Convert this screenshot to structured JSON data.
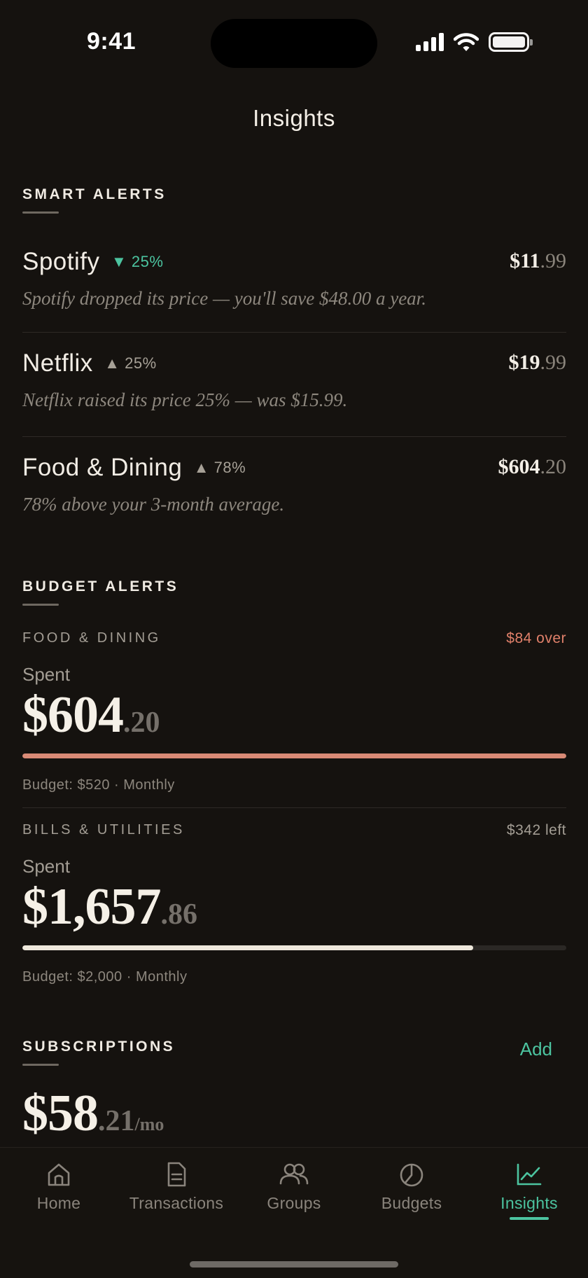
{
  "status_bar": {
    "time": "9:41"
  },
  "header": {
    "title": "Insights"
  },
  "smart_alerts": {
    "label": "SMART ALERTS",
    "items": [
      {
        "name": "Spotify",
        "direction": "down",
        "arrow": "▼",
        "change": "25%",
        "price_main": "$11",
        "price_cents": ".99",
        "description": "Spotify dropped its price — you'll save $48.00 a year."
      },
      {
        "name": "Netflix",
        "direction": "up",
        "arrow": "▲",
        "change": "25%",
        "price_main": "$19",
        "price_cents": ".99",
        "description": "Netflix raised its price 25% — was $15.99."
      },
      {
        "name": "Food & Dining",
        "direction": "up",
        "arrow": "▲",
        "change": "78%",
        "price_main": "$604",
        "price_cents": ".20",
        "description": "78% above your 3-month average."
      }
    ]
  },
  "budget_alerts": {
    "label": "BUDGET ALERTS",
    "items": [
      {
        "category": "FOOD & DINING",
        "status": "$84 over",
        "status_color": "#e0806a",
        "spent_label": "Spent",
        "amount_main": "$604",
        "amount_cents": ".20",
        "progress": 1.0,
        "progress_color": "#d98a76",
        "meta": "Budget: $520 · Monthly"
      },
      {
        "category": "BILLS & UTILITIES",
        "status": "$342 left",
        "status_color": "#a39d94",
        "spent_label": "Spent",
        "amount_main": "$1,657",
        "amount_cents": ".86",
        "progress": 0.829,
        "progress_color": "#eee8dc",
        "meta": "Budget: $2,000 · Monthly"
      }
    ]
  },
  "subscriptions": {
    "label": "SUBSCRIPTIONS",
    "add_label": "Add",
    "amount_main": "$58",
    "amount_cents": ".21",
    "period": "/mo"
  },
  "tab_bar": {
    "active": "Insights",
    "tabs": [
      {
        "label": "Home",
        "icon": "home-icon"
      },
      {
        "label": "Transactions",
        "icon": "document-icon"
      },
      {
        "label": "Groups",
        "icon": "people-icon"
      },
      {
        "label": "Budgets",
        "icon": "pie-chart-icon"
      },
      {
        "label": "Insights",
        "icon": "trend-chart-icon"
      }
    ]
  },
  "colors": {
    "accent": "#4cc4a0",
    "background": "#15120f",
    "over_budget": "#e0806a"
  }
}
